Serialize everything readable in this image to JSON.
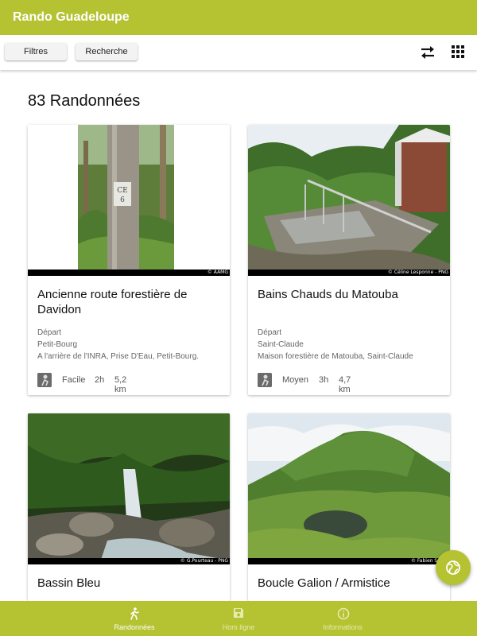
{
  "app": {
    "title": "Rando Guadeloupe"
  },
  "toolbar": {
    "filters_label": "Filtres",
    "search_label": "Recherche",
    "sort_icon": "swap-arrows-icon",
    "view_icon": "grid-view-icon"
  },
  "list": {
    "count_label": "83 Randonnées",
    "cards": [
      {
        "title": "Ancienne route forestière de Davidon",
        "departure_label": "Départ",
        "city": "Petit-Bourg",
        "address": "A l'arrière de l'INRA, Prise D'Eau, Petit-Bourg.",
        "difficulty": "Facile",
        "duration": "2h",
        "distance": "5,2 km",
        "photo_credit": "© AAMG"
      },
      {
        "title": "Bains Chauds du Matouba",
        "departure_label": "Départ",
        "city": "Saint-Claude",
        "address": "Maison forestière de Matouba, Saint-Claude",
        "difficulty": "Moyen",
        "duration": "3h",
        "distance": "4,7 km",
        "photo_credit": "© Céline Lesponne - PNG"
      },
      {
        "title": "Bassin Bleu",
        "photo_credit": "© G.Pourteau - PNG"
      },
      {
        "title": "Boucle Galion / Armistice",
        "photo_credit": "© Fabien Salles"
      }
    ]
  },
  "fab": {
    "icon": "globe-icon"
  },
  "bottom_nav": {
    "items": [
      {
        "label": "Randonnées",
        "icon": "hiker-icon",
        "active": true
      },
      {
        "label": "Hors ligne",
        "icon": "save-icon",
        "active": false
      },
      {
        "label": "Informations",
        "icon": "info-icon",
        "active": false
      }
    ]
  },
  "colors": {
    "primary": "#b5c332",
    "active_nav": "#ffffff",
    "inactive_nav": "#e5ecb0"
  }
}
